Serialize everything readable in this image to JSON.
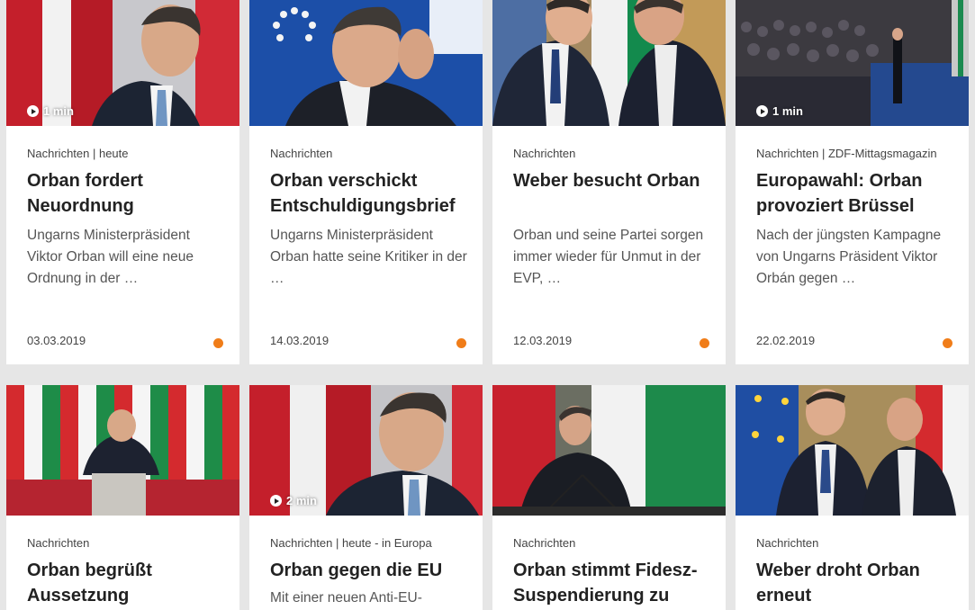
{
  "accent_color": "#f07d19",
  "cards": [
    {
      "kicker": "Nachrichten | heute",
      "title": "Orban fordert Neuordnung",
      "teaser": "Ungarns Ministerpräsident Viktor Orban will eine neue Ordnung in der …",
      "date": "03.03.2019",
      "duration": "1 min",
      "image": "orban-flag-photo"
    },
    {
      "kicker": "Nachrichten",
      "title": "Orban verschickt Entschuldigungsbrief",
      "teaser": "Ungarns Ministerpräsident Orban hatte seine Kritiker in der …",
      "date": "14.03.2019",
      "duration": "",
      "image": "orban-eu-photo"
    },
    {
      "kicker": "Nachrichten",
      "title": "Weber besucht Orban",
      "teaser": "Orban und seine Partei sorgen immer wieder für Unmut in der EVP, …",
      "date": "12.03.2019",
      "duration": "",
      "image": "weber-orban-handshake-photo"
    },
    {
      "kicker": "Nachrichten | ZDF-Mittagsmagazin",
      "title": "Europawahl: Orban provoziert Brüssel",
      "teaser": "Nach der jüngsten Kampagne von Ungarns Präsident Viktor Orbán gegen …",
      "date": "22.02.2019",
      "duration": "1 min",
      "image": "orban-stage-photo"
    },
    {
      "kicker": "Nachrichten",
      "title": "Orban begrüßt Aussetzung",
      "teaser": "",
      "date": "",
      "duration": "",
      "image": "orban-fidesz-podium-photo"
    },
    {
      "kicker": "Nachrichten | heute - in Europa",
      "title": "Orban gegen die EU",
      "teaser": "Mit einer neuen Anti-EU-",
      "date": "",
      "duration": "2 min",
      "image": "orban-flag-photo-2"
    },
    {
      "kicker": "Nachrichten",
      "title": "Orban stimmt Fidesz-Suspendierung zu",
      "teaser": "",
      "date": "",
      "duration": "",
      "image": "orban-microphones-photo"
    },
    {
      "kicker": "Nachrichten",
      "title": "Weber droht Orban erneut",
      "teaser": "",
      "date": "",
      "duration": "",
      "image": "weber-orban-flags-photo"
    }
  ]
}
